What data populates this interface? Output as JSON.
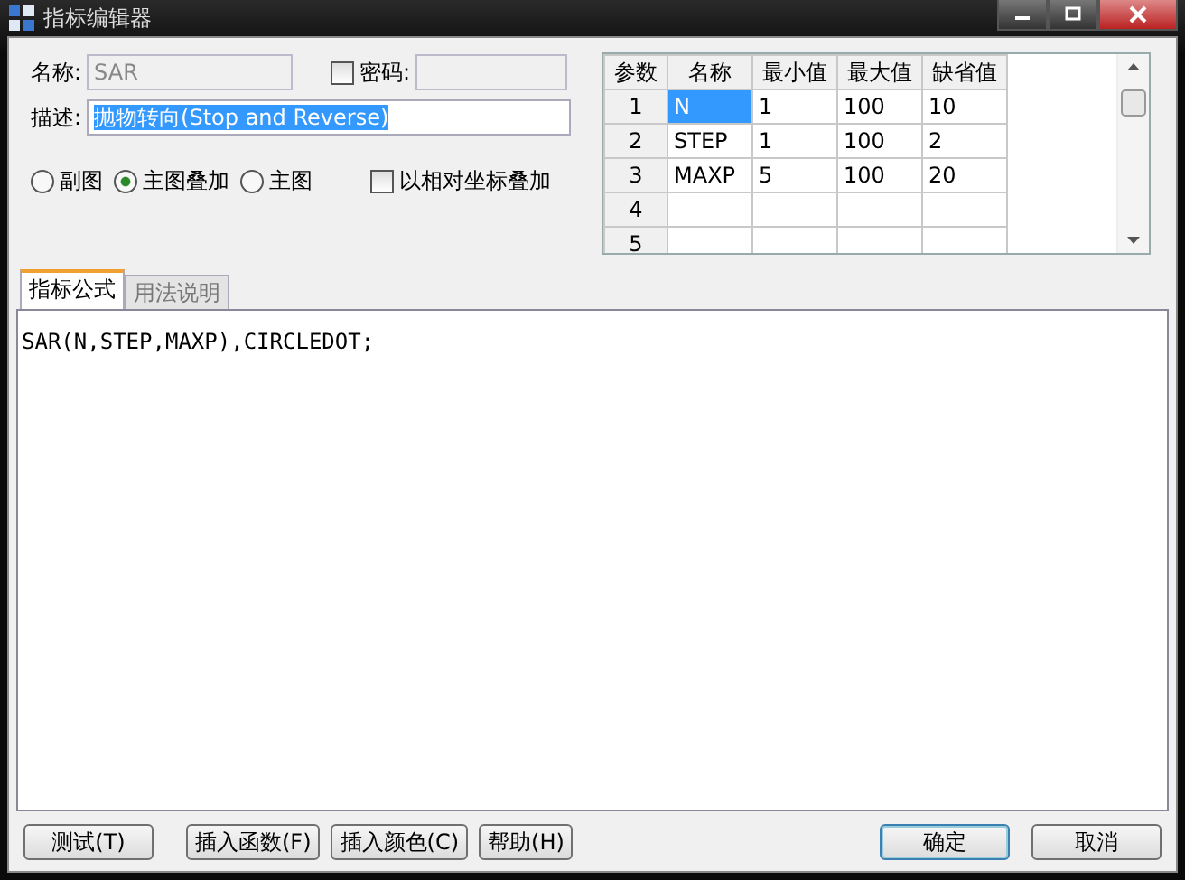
{
  "window": {
    "title": "指标编辑器"
  },
  "name_field": {
    "label": "名称:",
    "value": "SAR",
    "disabled": true
  },
  "password": {
    "label": "密码:",
    "checked": false,
    "value_disabled": true
  },
  "description": {
    "label": "描述:",
    "value": "抛物转向(Stop and Reverse)",
    "text_selected": true
  },
  "chart_types": [
    {
      "label": "副图",
      "selected": false
    },
    {
      "label": "主图叠加",
      "selected": true
    },
    {
      "label": "主图",
      "selected": false
    }
  ],
  "relative_overlay": {
    "label": "以相对坐标叠加",
    "checked": false
  },
  "params_table": {
    "columns": [
      "参数",
      "名称",
      "最小值",
      "最大值",
      "缺省值"
    ],
    "rows": [
      {
        "cells": [
          {
            "text": "1",
            "selected": false
          },
          {
            "text": "N",
            "selected": true
          },
          {
            "text": "1",
            "selected": false
          },
          {
            "text": "100",
            "selected": false
          },
          {
            "text": "10",
            "selected": false
          }
        ]
      },
      {
        "cells": [
          {
            "text": "2",
            "selected": false
          },
          {
            "text": "STEP",
            "selected": false
          },
          {
            "text": "1",
            "selected": false
          },
          {
            "text": "100",
            "selected": false
          },
          {
            "text": "2",
            "selected": false
          }
        ]
      },
      {
        "cells": [
          {
            "text": "3",
            "selected": false
          },
          {
            "text": "MAXP",
            "selected": false
          },
          {
            "text": "5",
            "selected": false
          },
          {
            "text": "100",
            "selected": false
          },
          {
            "text": "20",
            "selected": false
          }
        ]
      },
      {
        "cells": [
          {
            "text": "4",
            "selected": false
          },
          {
            "text": "",
            "selected": false
          },
          {
            "text": "",
            "selected": false
          },
          {
            "text": "",
            "selected": false
          },
          {
            "text": "",
            "selected": false
          }
        ]
      },
      {
        "cells": [
          {
            "text": "5",
            "selected": false
          },
          {
            "text": "",
            "selected": false
          },
          {
            "text": "",
            "selected": false
          },
          {
            "text": "",
            "selected": false
          },
          {
            "text": "",
            "selected": false
          }
        ]
      }
    ]
  },
  "tabs": [
    {
      "label": "指标公式",
      "selected": true
    },
    {
      "label": "用法说明",
      "selected": false
    }
  ],
  "formula": "SAR(N,STEP,MAXP),CIRCLEDOT;",
  "buttons_left": [
    "测试(T)",
    "插入函数(F)",
    "插入颜色(C)",
    "帮助(H)"
  ],
  "buttons_right": [
    {
      "label": "确定",
      "default": true
    },
    {
      "label": "取消",
      "default": false
    }
  ]
}
